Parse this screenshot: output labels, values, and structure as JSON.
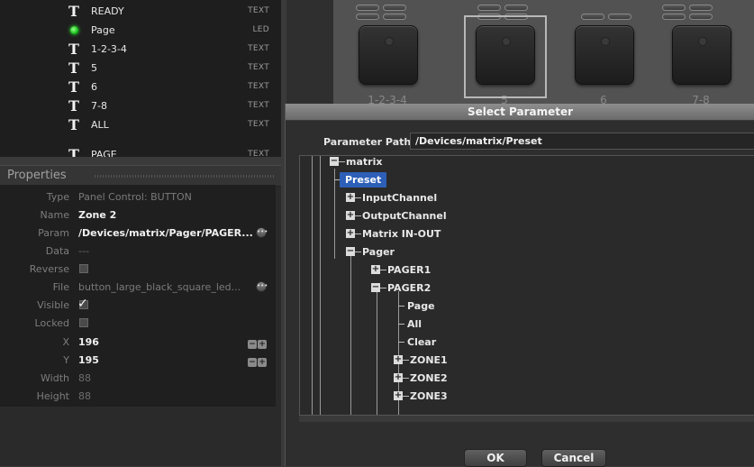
{
  "controls": [
    {
      "icon": "text-icon",
      "name": "READY",
      "type": "TEXT"
    },
    {
      "icon": "led-icon",
      "name": "Page",
      "type": "LED"
    },
    {
      "icon": "text-icon",
      "name": "1-2-3-4",
      "type": "TEXT"
    },
    {
      "icon": "text-icon",
      "name": "5",
      "type": "TEXT"
    },
    {
      "icon": "text-icon",
      "name": "6",
      "type": "TEXT"
    },
    {
      "icon": "text-icon",
      "name": "7-8",
      "type": "TEXT"
    },
    {
      "icon": "text-icon",
      "name": "ALL",
      "type": "TEXT"
    },
    {
      "icon": "text-icon",
      "name": "PAGE",
      "type": "TEXT"
    }
  ],
  "properties": {
    "title": "Properties",
    "rows": {
      "type": {
        "label": "Type",
        "value": "Panel Control: BUTTON"
      },
      "name": {
        "label": "Name",
        "value": "Zone 2"
      },
      "param": {
        "label": "Param",
        "value": "/Devices/matrix/Pager/PAGER..."
      },
      "data": {
        "label": "Data",
        "value": "---"
      },
      "reverse": {
        "label": "Reverse",
        "checked": false
      },
      "file": {
        "label": "File",
        "value": "button_large_black_square_led..."
      },
      "visible": {
        "label": "Visible",
        "checked": true
      },
      "locked": {
        "label": "Locked",
        "checked": false
      },
      "x": {
        "label": "X",
        "value": "196"
      },
      "y": {
        "label": "Y",
        "value": "195"
      },
      "width": {
        "label": "Width",
        "value": "88"
      },
      "height": {
        "label": "Height",
        "value": "88"
      }
    }
  },
  "canvas": {
    "pad_labels": [
      "1-2-3-4",
      "5",
      "6",
      "7-8"
    ]
  },
  "dialog": {
    "title": "Select Parameter",
    "path_label": "Parameter Path",
    "path_value": "/Devices/matrix/Preset",
    "tree": {
      "matrix": "matrix",
      "preset": "Preset",
      "input_channel": "InputChannel",
      "output_channel": "OutputChannel",
      "matrix_in_out": "Matrix IN-OUT",
      "pager": "Pager",
      "pager1": "PAGER1",
      "pager2": "PAGER2",
      "page": "Page",
      "all": "All",
      "clear": "Clear",
      "zone1": "ZONE1",
      "zone2": "ZONE2",
      "zone3": "ZONE3"
    },
    "ok_label": "OK",
    "cancel_label": "Cancel"
  }
}
